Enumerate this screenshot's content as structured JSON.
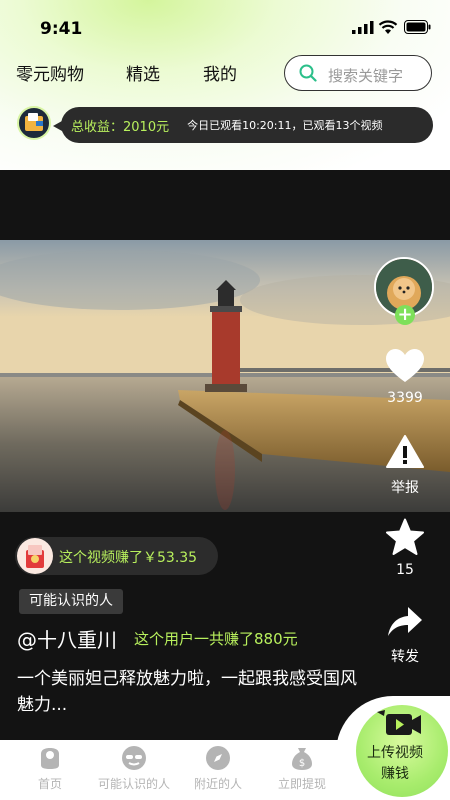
{
  "status_bar": {
    "time": "9:41"
  },
  "nav": {
    "links": [
      {
        "label": "零元购物"
      },
      {
        "label": "精选"
      },
      {
        "label": "我的"
      }
    ],
    "search_placeholder": "搜索关键字"
  },
  "earnings": {
    "total_label": "总收益：",
    "total_value": "2010元",
    "progress_text": "今日已观看10:20:11，已观看13个视频"
  },
  "video": {
    "side_actions": {
      "like_count": "3399",
      "report_label": "举报",
      "favorite_count": "15",
      "share_label": "转发"
    },
    "video_earned_text": "这个视频赚了￥53.35",
    "tag": "可能认识的人",
    "author_handle": "@十八重川",
    "author_earned": "这个用户一共赚了880元",
    "caption": "一个美丽妲己释放魅力啦，一起跟我感受国风魅力..."
  },
  "bottom_tabs": [
    {
      "label": "首页",
      "icon": "home-icon"
    },
    {
      "label": "可能认识的人",
      "icon": "people-icon"
    },
    {
      "label": "附近的人",
      "icon": "compass-icon"
    },
    {
      "label": "立即提现",
      "icon": "money-bag-icon"
    }
  ],
  "upload_button": {
    "line1": "上传视频",
    "line2": "赚钱"
  },
  "colors": {
    "accent_green": "#b8f05d",
    "button_green": "#a8ec6d",
    "dark_bg": "#111111"
  }
}
